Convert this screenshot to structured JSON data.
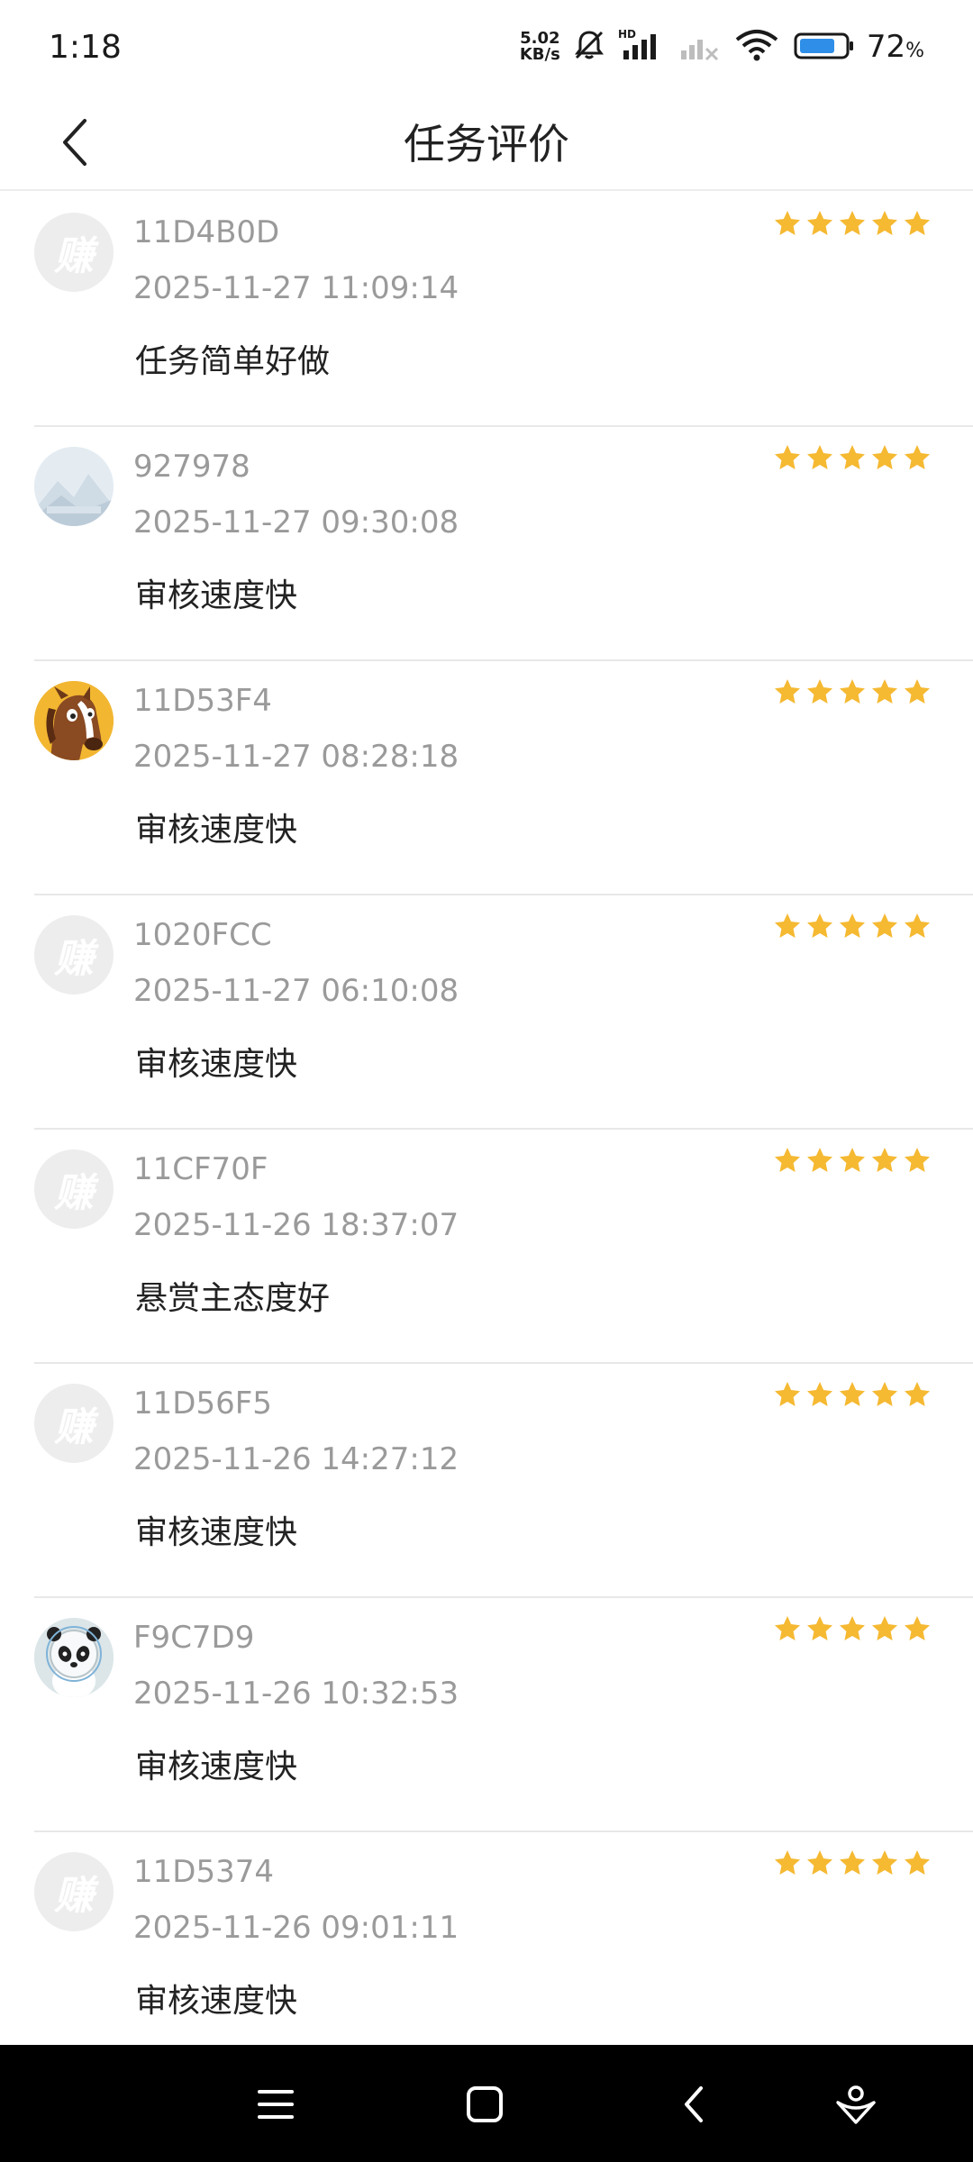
{
  "status_bar": {
    "time": "1:18",
    "net_speed_value": "5.02",
    "net_speed_unit": "KB/s",
    "battery_percent": "72",
    "battery_unit": "%"
  },
  "header": {
    "title": "任务评价"
  },
  "colors": {
    "star": "#F5B932",
    "avatar_placeholder": "#EDEDED"
  },
  "reviews": [
    {
      "user": "11D4B0D",
      "time": "2025-11-27 11:09:14",
      "text": "任务简单好做",
      "avatar": "placeholder",
      "avatar_char": "赚",
      "rating": 5
    },
    {
      "user": "927978",
      "time": "2025-11-27 09:30:08",
      "text": "审核速度快",
      "avatar": "landscape-icon",
      "rating": 5
    },
    {
      "user": "11D53F4",
      "time": "2025-11-27 08:28:18",
      "text": "审核速度快",
      "avatar": "horse-cartoon",
      "rating": 5
    },
    {
      "user": "1020FCC",
      "time": "2025-11-27 06:10:08",
      "text": "审核速度快",
      "avatar": "placeholder",
      "avatar_char": "赚",
      "rating": 5
    },
    {
      "user": "11CF70F",
      "time": "2025-11-26 18:37:07",
      "text": "悬赏主态度好",
      "avatar": "placeholder",
      "avatar_char": "赚",
      "rating": 5
    },
    {
      "user": "11D56F5",
      "time": "2025-11-26 14:27:12",
      "text": "审核速度快",
      "avatar": "placeholder",
      "avatar_char": "赚",
      "rating": 5
    },
    {
      "user": "F9C7D9",
      "time": "2025-11-26 10:32:53",
      "text": "审核速度快",
      "avatar": "panda-mascot",
      "rating": 5
    },
    {
      "user": "11D5374",
      "time": "2025-11-26 09:01:11",
      "text": "审核速度快",
      "avatar": "placeholder",
      "avatar_char": "赚",
      "rating": 5
    }
  ],
  "nav_bar": {
    "buttons": [
      "menu-icon",
      "home-icon",
      "back-icon",
      "assistant-icon"
    ]
  }
}
